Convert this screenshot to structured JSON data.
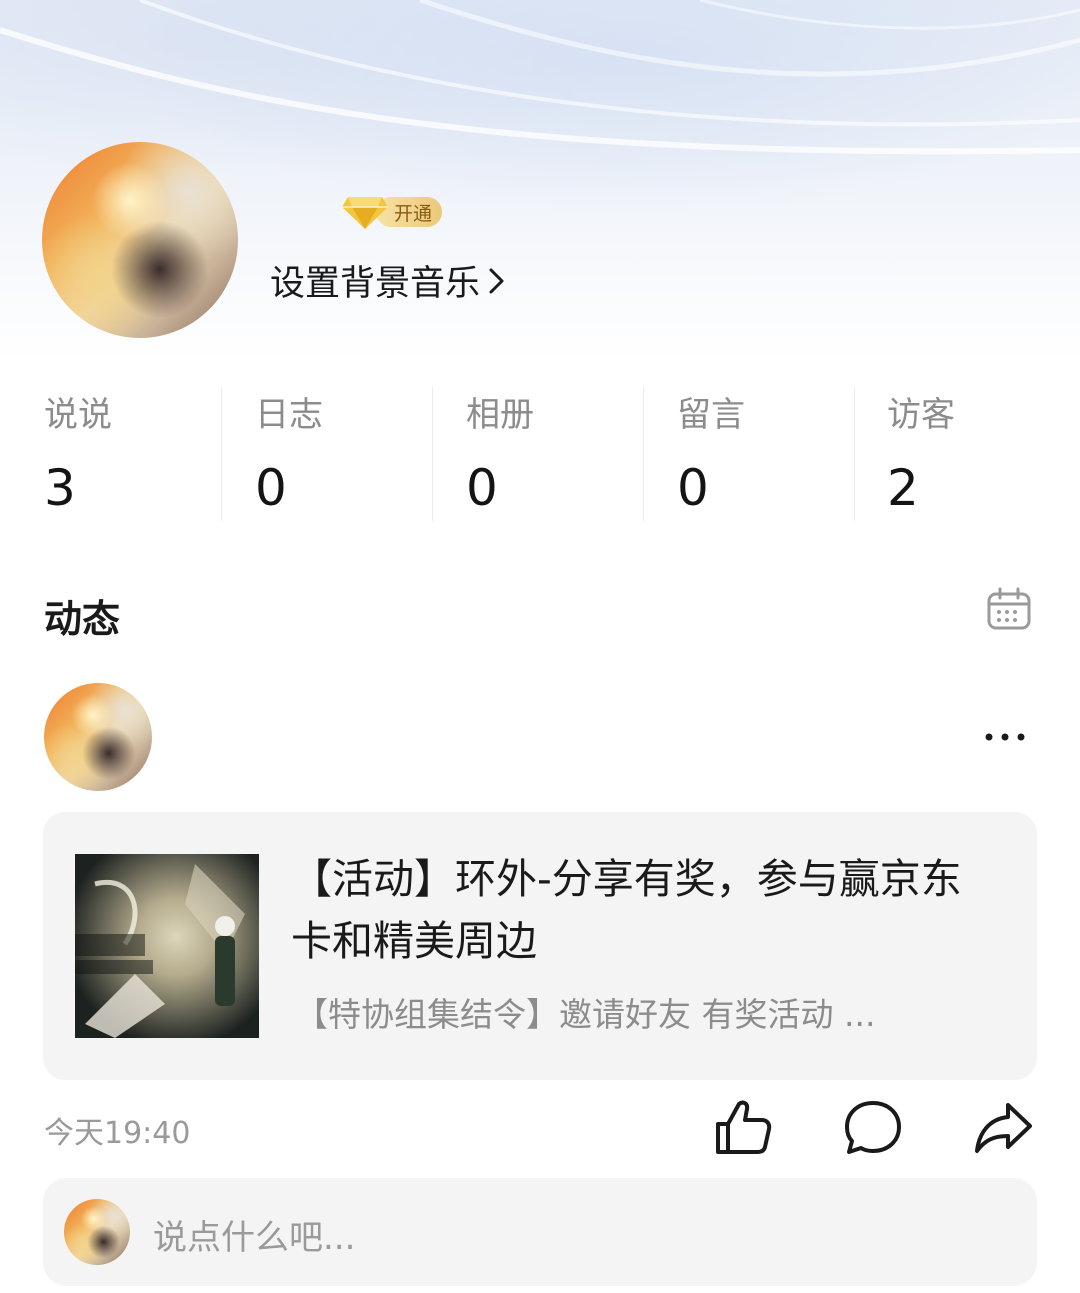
{
  "profile": {
    "vip_label": "开通",
    "bgm_link": "设置背景音乐",
    "bgm_chevron": "›"
  },
  "stats": [
    {
      "label": "说说",
      "value": "3"
    },
    {
      "label": "日志",
      "value": "0"
    },
    {
      "label": "相册",
      "value": "0"
    },
    {
      "label": "留言",
      "value": "0"
    },
    {
      "label": "访客",
      "value": "2"
    }
  ],
  "feed": {
    "section_title": "动态",
    "calendar_icon": "calendar-icon",
    "post": {
      "more_icon": "more-icon",
      "share": {
        "title": "【活动】环外-分享有奖，参与赢京东卡和精美周边",
        "subtitle": "【特协组集结令】邀请好友 有奖活动 ..."
      },
      "time": "今天19:40",
      "actions": [
        "like-icon",
        "comment-icon",
        "share-icon"
      ]
    },
    "comment": {
      "placeholder": "说点什么吧..."
    }
  },
  "colors": {
    "accent_gold": "#ecc97a",
    "text_primary": "#1a1a1a",
    "text_secondary": "#8c8c8c",
    "card_bg": "#f4f4f4"
  }
}
